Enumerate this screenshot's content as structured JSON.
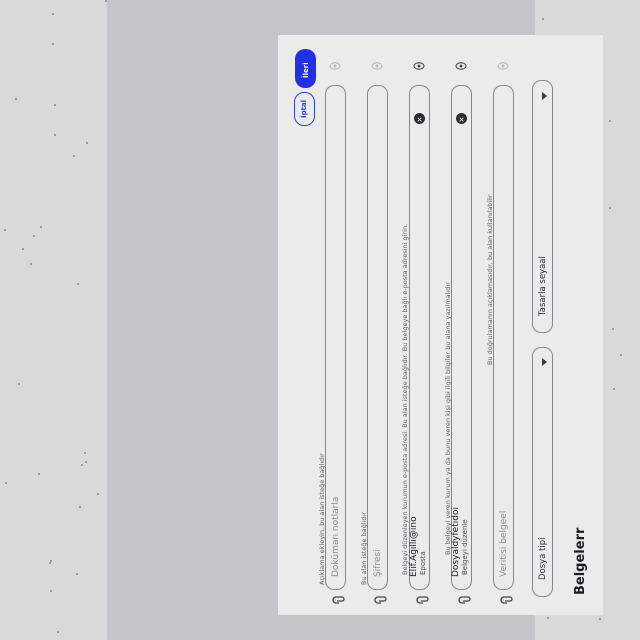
{
  "dialog": {
    "title": "Belgelerr",
    "selects": [
      {
        "label": "Dosya tipi"
      },
      {
        "label": "Tasarla seyaal"
      }
    ],
    "fields": [
      {
        "id": "document-label",
        "value": "",
        "placeholder": "Veritisi belgeel",
        "helper": "Bu doğrulamanın açıklamasıdır, bu alan kullanılabilir"
      },
      {
        "id": "issuing-authority",
        "value": "Dosyaldyfetıdoi",
        "floating_label": "Belgeyi düzenle",
        "helper": "Bu belgeyi veren kurum ya da bunu veren kişi gibi ilgili bilgiler bu alana yazılmalıdır"
      },
      {
        "id": "email",
        "value": "Elif.Ağıllı@ino",
        "floating_label": "Eposta",
        "helper": "Belgeyi düzenleyen kurumun e-posta adresi. Bu alan isteğe bağlıdır. Bu belgeye bağlı e-posta adresini girin."
      },
      {
        "id": "password",
        "value": "",
        "placeholder": "Şifresi",
        "helper": "Bu alan isteğe bağlıdır"
      },
      {
        "id": "description",
        "value": "",
        "placeholder": "Doküman notlarla",
        "helper": "Açıklama ekleyin, bu alan isteğe bağlıdır"
      }
    ],
    "actions": {
      "cancel_label": "İptal",
      "submit_label": "İleri"
    }
  },
  "colors": {
    "primary": "#2130e5",
    "sheet": "#ebebec",
    "backdrop": "#d9d9da"
  },
  "icons": [
    "paperclip-icon",
    "eye-icon",
    "clear-icon",
    "dropdown-arrow-icon"
  ]
}
